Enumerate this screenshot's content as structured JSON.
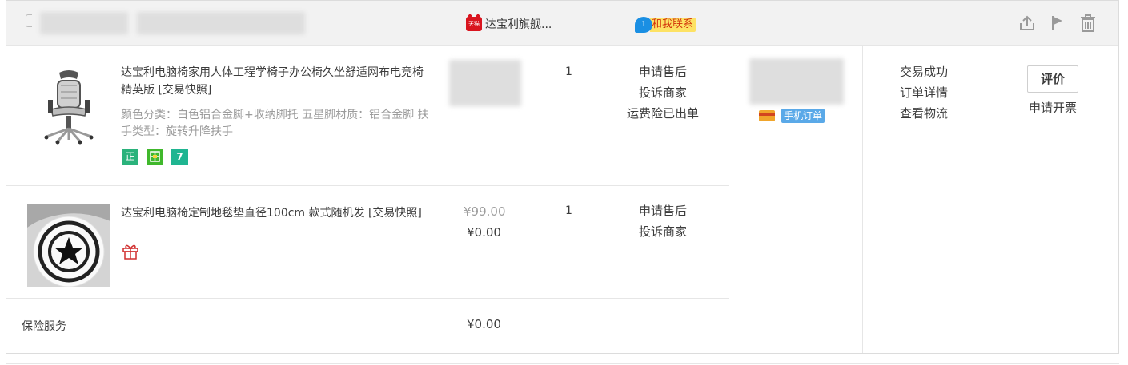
{
  "header": {
    "shop_name": "达宝利旗舰...",
    "tmall_icon": "tmall-cat-icon",
    "tmall_text": "天猫",
    "contact_label": "和我联系",
    "wangwang_icon": "wangwang-icon",
    "icons": [
      "share-icon",
      "flag-icon",
      "trash-icon"
    ]
  },
  "items": [
    {
      "title": "达宝利电脑椅家用人体工程学椅子办公椅久坐舒适网布电竞椅精英版",
      "snapshot": "[交易快照]",
      "attrs": "颜色分类：白色铝合金脚+收纳脚托  五星脚材质：铝合金脚  扶手类型：旋转升降扶手",
      "badges": [
        "正",
        "",
        "7"
      ],
      "badge_icons": [
        "genuine-icon",
        "guarantee-icon",
        "seven-day-return-icon"
      ],
      "quantity": "1",
      "services": [
        "申请售后",
        "投诉商家",
        "运费险已出单"
      ]
    },
    {
      "title": "达宝利电脑椅定制地毯垫直径100cm 款式随机发",
      "snapshot": "[交易快照]",
      "price_original": "¥99.00",
      "price": "¥0.00",
      "quantity": "1",
      "gift_icon": "gift-icon",
      "services": [
        "申请售后",
        "投诉商家"
      ]
    }
  ],
  "insurance": {
    "label": "保险服务",
    "price": "¥0.00"
  },
  "payment": {
    "card_icon": "card-icon",
    "mobile_tag": "手机订单"
  },
  "status": {
    "lines": [
      "交易成功",
      "订单详情",
      "查看物流"
    ]
  },
  "actions": {
    "rate": "评价",
    "invoice": "申请开票"
  },
  "colors": {
    "header_bg": "#f2f2f2",
    "tmall_red": "#d9151f",
    "contact_yellow": "#fde264",
    "contact_text": "#d12f09",
    "wangwang_blue": "#1a8fe3",
    "mobile_tag_blue": "#5aa9e8",
    "muted_text": "#9c9c9c",
    "badge_green": "#2ab27b"
  }
}
